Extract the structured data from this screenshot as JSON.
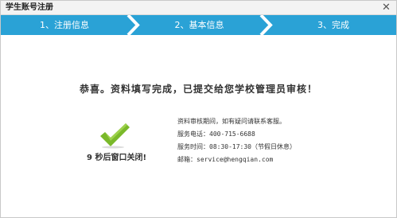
{
  "window": {
    "title": "学生账号注册",
    "close_glyph": "✕"
  },
  "steps": [
    {
      "label": "1、注册信息",
      "active": true
    },
    {
      "label": "2、基本信息",
      "active": true
    },
    {
      "label": "3、完成",
      "active": true
    }
  ],
  "colors": {
    "step_active": "#2aa2d6",
    "divider": "#ffffff",
    "check": "#7ab92a"
  },
  "message": "恭喜。资料填写完成，已提交给您学校管理员审核！",
  "countdown": {
    "seconds": "9",
    "text": "秒后窗口关闭!"
  },
  "info": {
    "review_note": "资料审核期间，如有疑问请联系客服。",
    "phone_label": "服务电话：",
    "phone_value": "400-715-6688",
    "hours_label": "服务时间：",
    "hours_value": "08:30-17:30（节假日休息）",
    "email_label": "邮箱：",
    "email_value": "service@hengqian.com"
  },
  "icons": {
    "close": "close-icon",
    "success": "checkmark-icon"
  }
}
